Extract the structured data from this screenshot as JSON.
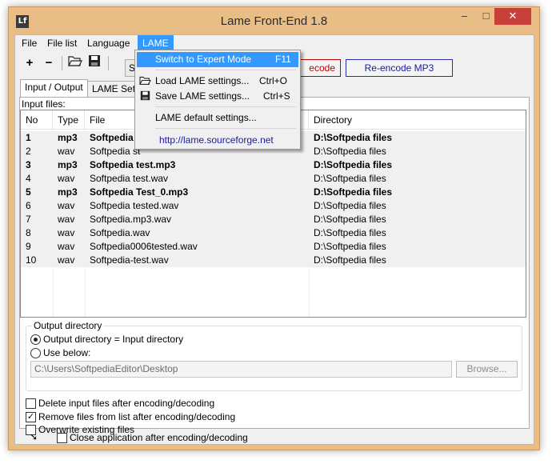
{
  "window": {
    "title": "Lame Front-End 1.8",
    "minimize": "–",
    "maximize": "□",
    "close": "✕",
    "icon_text": "Lf"
  },
  "menubar": {
    "items": [
      "File",
      "File list",
      "Language",
      "LAME"
    ],
    "active": "LAME"
  },
  "toolbar": {
    "add_icon": "+",
    "remove_icon": "−",
    "open_icon": "open-folder-icon",
    "save_icon": "floppy-icon",
    "switch_button_partial": "Sw",
    "decode_button_partial": "ecode",
    "reencode_button": "Re-encode MP3"
  },
  "tabs": [
    {
      "label": "Input / Output",
      "active": true
    },
    {
      "label": "LAME Settings",
      "active": false
    }
  ],
  "input_files": {
    "label": "Input files:",
    "columns": [
      "No",
      "Type",
      "File",
      "Directory"
    ],
    "rows": [
      {
        "no": "1",
        "type": "mp3",
        "file": "Softpedia",
        "dir": "D:\\Softpedia files",
        "bold": true,
        "sel": true
      },
      {
        "no": "2",
        "type": "wav",
        "file": "Softpedia st",
        "dir": "D:\\Softpedia files",
        "bold": false,
        "sel": true
      },
      {
        "no": "3",
        "type": "mp3",
        "file": "Softpedia test.mp3",
        "dir": "D:\\Softpedia files",
        "bold": true,
        "sel": true
      },
      {
        "no": "4",
        "type": "wav",
        "file": "Softpedia test.wav",
        "dir": "D:\\Softpedia files",
        "bold": false,
        "sel": true
      },
      {
        "no": "5",
        "type": "mp3",
        "file": "Softpedia Test_0.mp3",
        "dir": "D:\\Softpedia files",
        "bold": true,
        "sel": true
      },
      {
        "no": "6",
        "type": "wav",
        "file": "Softpedia tested.wav",
        "dir": "D:\\Softpedia files",
        "bold": false,
        "sel": true
      },
      {
        "no": "7",
        "type": "wav",
        "file": "Softpedia.mp3.wav",
        "dir": "D:\\Softpedia files",
        "bold": false,
        "sel": true
      },
      {
        "no": "8",
        "type": "wav",
        "file": "Softpedia.wav",
        "dir": "D:\\Softpedia files",
        "bold": false,
        "sel": true
      },
      {
        "no": "9",
        "type": "wav",
        "file": "Softpedia0006tested.wav",
        "dir": "D:\\Softpedia files",
        "bold": false,
        "sel": true
      },
      {
        "no": "10",
        "type": "wav",
        "file": "Softpedia-test.wav",
        "dir": "D:\\Softpedia files",
        "bold": false,
        "sel": true
      }
    ]
  },
  "output_directory": {
    "title": "Output directory",
    "option_same": "Output directory = Input directory",
    "option_below": "Use below:",
    "selected": "same",
    "path": "C:\\Users\\SoftpediaEditor\\Desktop",
    "browse": "Browse..."
  },
  "options": [
    {
      "label": "Delete input files after encoding/decoding",
      "checked": false
    },
    {
      "label": "Remove files from list after encoding/decoding",
      "checked": true
    },
    {
      "label": "Overwrite existing files",
      "checked": false
    }
  ],
  "statusbar": {
    "close_after": "Close application after encoding/decoding",
    "close_after_checked": false
  },
  "lame_menu": {
    "items": [
      {
        "label": "Switch to Expert Mode",
        "shortcut": "F11",
        "highlighted": true
      },
      {
        "label": "Load LAME settings...",
        "shortcut": "Ctrl+O",
        "icon": "open-folder-icon"
      },
      {
        "label": "Save LAME settings...",
        "shortcut": "Ctrl+S",
        "icon": "floppy-icon"
      },
      {
        "label": "LAME default settings...",
        "shortcut": ""
      }
    ],
    "link": "http://lame.sourceforge.net"
  },
  "colors": {
    "frame": "#e8bd86",
    "highlight": "#3399ff",
    "reencode": "#1a1aa6",
    "decode": "#c00000"
  }
}
